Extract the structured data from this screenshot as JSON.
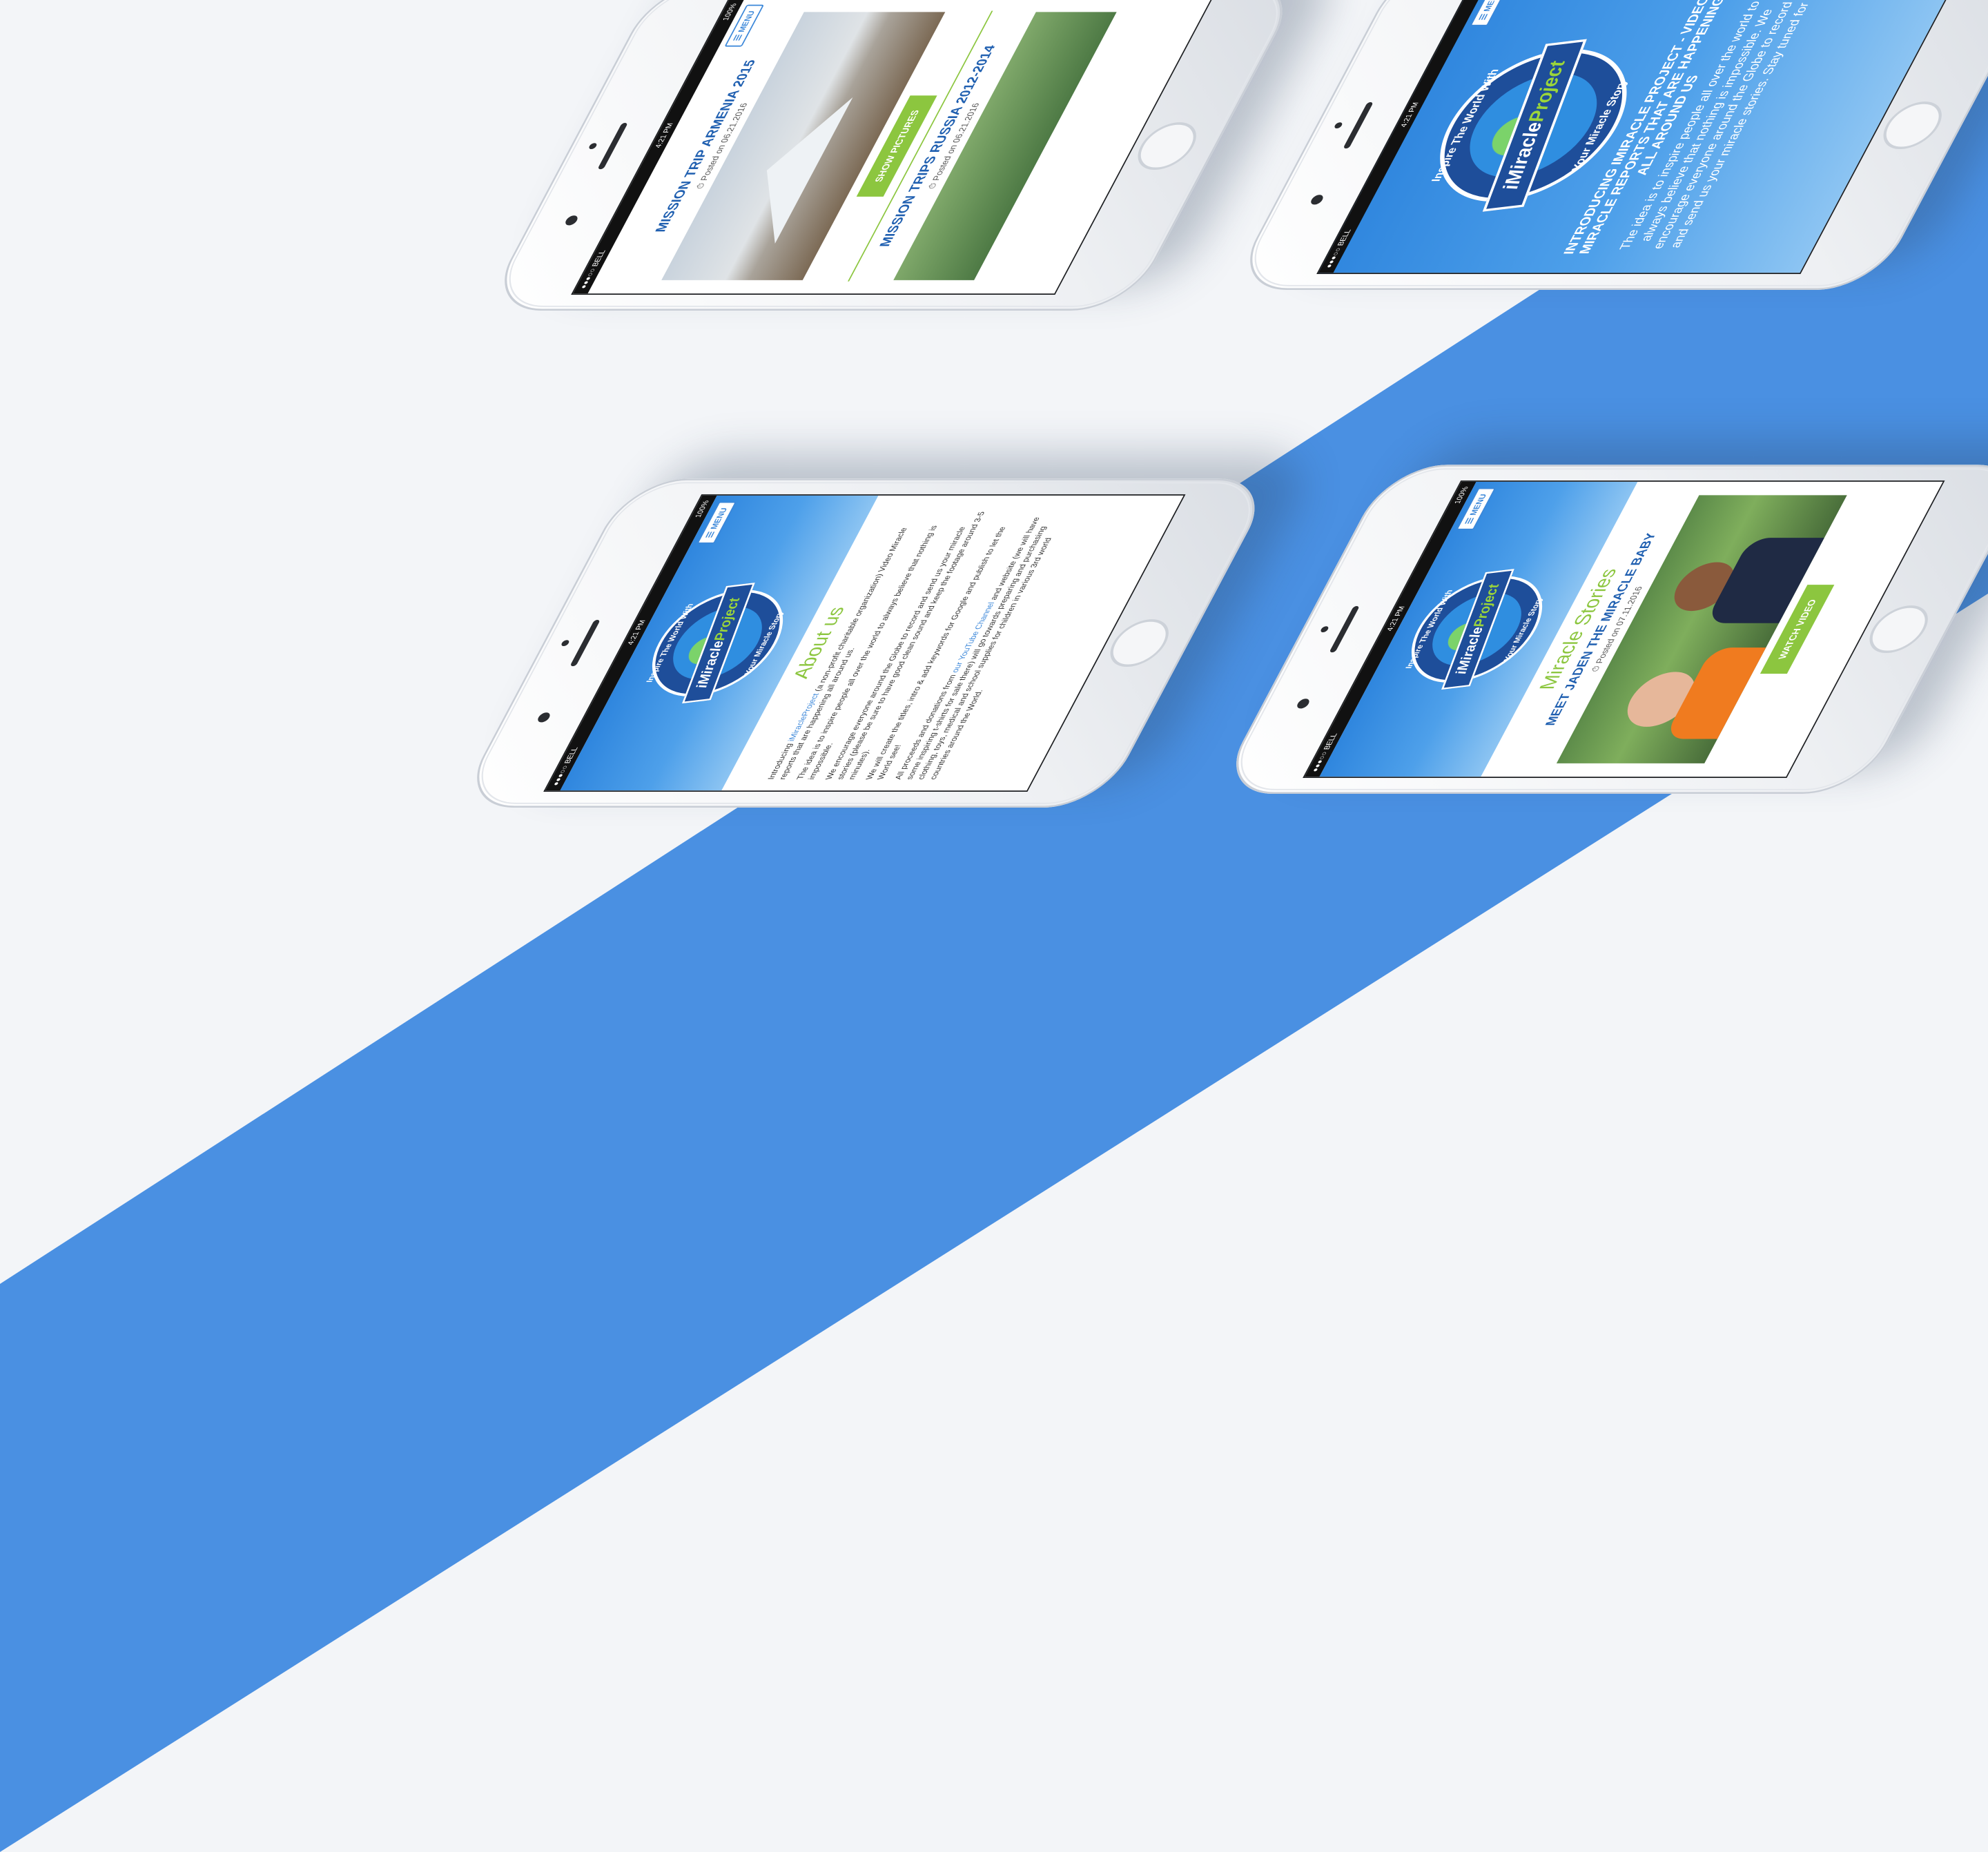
{
  "colors": {
    "background": "#f3f5f8",
    "diagonal_band": "#4a90e2",
    "accent_blue": "#1f5fb0",
    "accent_green": "#8cc63f"
  },
  "status_bar": {
    "carrier": "●●●○○ BELL",
    "wifi_icon": "wifi-icon",
    "time": "4:21 PM",
    "bluetooth_icon": "bluetooth-icon",
    "battery": "100%"
  },
  "menu_label": "☰ MENU",
  "logo": {
    "top_text": "Inspire The World With",
    "name_prefix": "iMiracle",
    "name_suffix": "Project",
    "bottom_text": "Your Miracle Story"
  },
  "phone_mission": {
    "post1": {
      "title": "MISSION TRIP ARMENIA 2015",
      "posted": "Posted on 06.21.2016",
      "button": "SHOW PICTURES"
    },
    "post2": {
      "title": "MISSION TRIPS RUSSIA 2012-2014",
      "posted": "Posted on 06.21.2016"
    }
  },
  "phone_intro": {
    "heading": "INTRODUCING IMIRACLE PROJECT - VIDEO MIRACLE REPORTS THAT ARE HAPPENING ALL AROUND US",
    "body": "The idea is to inspire people all over the world to always believe that nothing is impossible. We encourage everyone around the Globe to record and send us your miracle stories. Stay tuned for"
  },
  "phone_about": {
    "title": "About us",
    "p1_prefix": "Introducing ",
    "p1_link": "iMiracleProject",
    "p1_suffix": " (a non-profit charitable organization) Video Miracle reports that are happening all around us.",
    "p2": "The idea is to inspire people all over the world to always believe that nothing is impossible.",
    "p3": "We encourage everyone around the Globe to record and send us your miracle stories (please be sure to have good clean sound and keep the footage around 3-5 minutes).",
    "p4": "We will create the titles, intro & add keywords for Google and publish to let the World see!",
    "p5_prefix": "All proceeds and donations from ",
    "p5_link": "our YouTube Channel",
    "p5_suffix": " and website (we will have some inspiring t-shirts for sale there) will go towards preparing and purchasing clothing, toys, medical and school supplies for children in various 3rd world countries around the World."
  },
  "phone_stories": {
    "title": "Miracle Stories",
    "post_title": "MEET JADEN THE MIRACLE BABY",
    "posted": "Posted on 07.11.2016",
    "button": "WATCH VIDEO"
  }
}
